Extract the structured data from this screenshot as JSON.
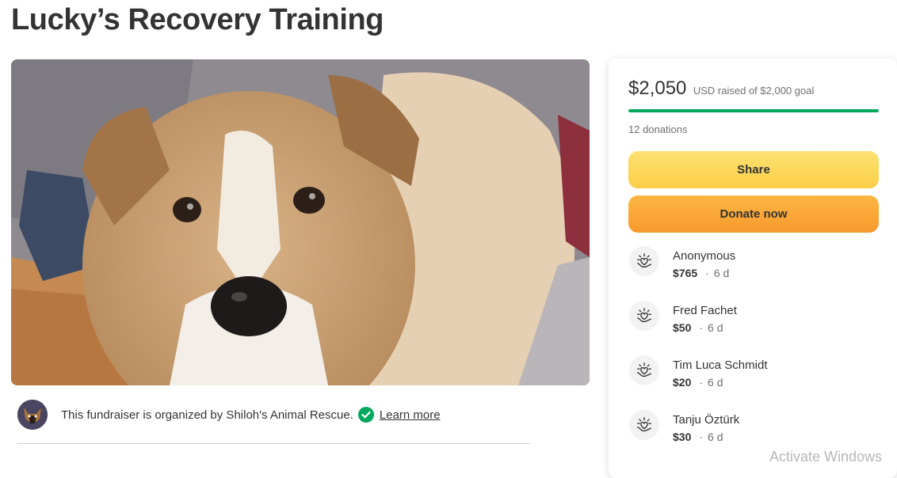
{
  "page": {
    "title": "Lucky’s Recovery Training"
  },
  "organizer": {
    "text": "This fundraiser is organized by Shiloh's Animal Rescue.",
    "learn_more": "Learn more"
  },
  "sidebar": {
    "raised_amount": "$2,050",
    "raised_text": "USD raised of $2,000 goal",
    "progress_fraction": 1.0,
    "donations_count": "12 donations",
    "share_label": "Share",
    "donate_label": "Donate now",
    "donors": [
      {
        "name": "Anonymous",
        "amount": "$765",
        "separator": "·",
        "time": "6 d"
      },
      {
        "name": "Fred Fachet",
        "amount": "$50",
        "separator": "·",
        "time": "6 d"
      },
      {
        "name": "Tim Luca Schmidt",
        "amount": "$20",
        "separator": "·",
        "time": "6 d"
      },
      {
        "name": "Tanju Öztürk",
        "amount": "$30",
        "separator": "·",
        "time": "6 d"
      }
    ]
  },
  "system": {
    "watermark": "Activate Windows"
  },
  "colors": {
    "progress": "#02a95c",
    "share_button": "#fbce46",
    "donate_button": "#f79a2d",
    "verified": "#02a95c"
  },
  "icons": {
    "verified": "check-circle-icon",
    "donor": "heart-hands-icon"
  }
}
